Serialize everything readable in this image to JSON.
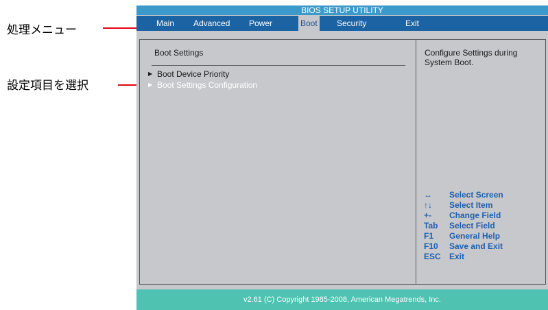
{
  "annotations": {
    "menu_label": "処理メニュー",
    "select_label": "設定項目を選択"
  },
  "bios": {
    "title": "BIOS SETUP UTILITY",
    "menu": [
      "Main",
      "Advanced",
      "Power",
      "Boot",
      "Security",
      "Exit"
    ],
    "selected_menu": "Boot",
    "section_title": "Boot Settings",
    "options": [
      "Boot Device Priority",
      "Boot Settings Configuration"
    ],
    "selected_option": "Boot Settings Configuration",
    "help_text": "Configure Settings during System Boot.",
    "keys": [
      {
        "key": "↔",
        "desc": "Select Screen"
      },
      {
        "key": "↑↓",
        "desc": "Select Item"
      },
      {
        "key": "+-",
        "desc": "Change Field"
      },
      {
        "key": "Tab",
        "desc": "Select Field"
      },
      {
        "key": "F1",
        "desc": "General Help"
      },
      {
        "key": "F10",
        "desc": "Save and Exit"
      },
      {
        "key": "ESC",
        "desc": "Exit"
      }
    ],
    "footer": "v2.61  (C) Copyright 1985-2008,  American  Megatrends,  Inc."
  },
  "colors": {
    "background": "#c7c8cb",
    "menubar": "#1c63a4",
    "titlebar": "#3b9ac9",
    "footer": "#4fc2b1",
    "key_text": "#1f5fb0",
    "annotation_line": "#e60012"
  }
}
